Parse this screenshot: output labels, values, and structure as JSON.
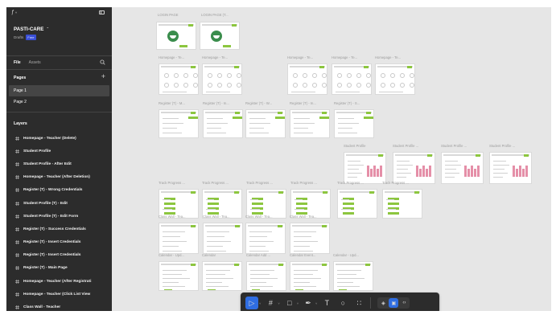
{
  "app": {
    "logo_glyph": "ƒ",
    "logo_caret": "˅"
  },
  "project": {
    "name": "PASTI-CARE",
    "location": "Drafts",
    "plan_badge": "Free"
  },
  "tabs": [
    {
      "label": "File",
      "active": true
    },
    {
      "label": "Assets",
      "active": false
    }
  ],
  "pages": {
    "title": "Pages",
    "add_glyph": "+",
    "items": [
      {
        "label": "Page 1",
        "selected": true
      },
      {
        "label": "Page 2",
        "selected": false
      }
    ]
  },
  "layers": {
    "title": "Layers",
    "items": [
      "Homepage - Teacher (Delete)",
      "Student Profile",
      "Student Profile - After Edit",
      "Homepage - Teacher (After Deletion)",
      "Register (T) - Wrong Credentials",
      "Student Profile (T) - Edit",
      "Student Profile (T) - Edit Form",
      "Register (T) - Success Credentials",
      "Register (T) - Insert Credentials",
      "Register (T) - Insert Credentials",
      "Register (T) - Main Page",
      "Homepage - Teacher (After Registrati",
      "Homepage - Teacher (Click List View",
      "Class Wall - Teacher"
    ]
  },
  "canvas": {
    "login_labels": [
      "LOGIN PAGE",
      "LOGIN PAGE (T..."
    ],
    "homepage_labels": [
      "Homepage - Te...",
      "Homepage - Te...",
      "Homepage - Te...",
      "Homepage - Te...",
      "Homepage - Te..."
    ],
    "register_labels": [
      "Register (T) - M...",
      "Register (T) - In...",
      "Register (T) - W...",
      "Register (T) - In...",
      "Register (T) - S..."
    ],
    "student_labels": [
      "Student Profile",
      "Student Profile ...",
      "Student Profile ...",
      "Student Profile ..."
    ],
    "track_labels": [
      "Track Progress ...",
      "Track Progress ...",
      "Track Progress ...",
      "Track Progress ...",
      "Track Progress ...",
      "Track Progress ..."
    ],
    "classwall_labels": [
      "Class Wall - Tea...",
      "Class Wall - Tea...",
      "Class Wall - Tea...",
      "Class Wall - Tea..."
    ],
    "calendar_labels": [
      "Calendar - Upd...",
      "Calendar",
      "Calendar Add ...",
      "Calendar Event...",
      "Calendar - Upd..."
    ]
  },
  "toolbar": {
    "tools": [
      {
        "name": "move-tool",
        "glyph": "▷",
        "active": true,
        "caret": true
      },
      {
        "name": "frame-tool",
        "glyph": "#",
        "active": false,
        "caret": true
      },
      {
        "name": "shape-tool",
        "glyph": "□",
        "active": false,
        "caret": true
      },
      {
        "name": "pen-tool",
        "glyph": "✒",
        "active": false,
        "caret": true
      },
      {
        "name": "text-tool",
        "glyph": "T",
        "active": false,
        "caret": false
      },
      {
        "name": "comment-tool",
        "glyph": "○",
        "active": false,
        "caret": false
      },
      {
        "name": "actions-tool",
        "glyph": "∷",
        "active": false,
        "caret": false
      }
    ],
    "caret_glyph": "˅",
    "mode_toggles": [
      {
        "name": "design-mode",
        "glyph": "◈",
        "active": false
      },
      {
        "name": "prototype-mode",
        "glyph": "▣",
        "active": true
      },
      {
        "name": "dev-mode",
        "glyph": "‹›",
        "active": false
      }
    ]
  },
  "colors": {
    "accent": "#2f6de1",
    "green": "#8cc63f",
    "sidebar_bg": "#2c2c2c",
    "canvas_bg": "#e6e6e6"
  }
}
